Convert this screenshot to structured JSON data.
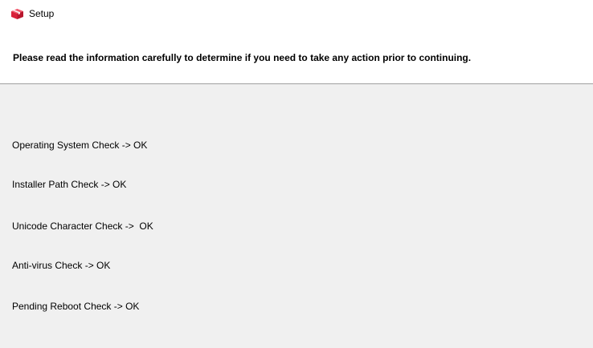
{
  "window": {
    "title": "Setup",
    "icon": "setup-box-icon"
  },
  "header": {
    "instruction": "Please read the information carefully to determine if you need to take any action prior to continuing."
  },
  "checks": [
    "Operating System Check -> OK",
    "Installer Path Check -> OK",
    "Unicode Character Check ->  OK",
    "Anti-virus Check -> OK",
    "Pending Reboot Check -> OK"
  ],
  "colors": {
    "icon_red": "#d9213a",
    "content_background": "#f0f0f0",
    "separator": "#a0a0a0"
  }
}
